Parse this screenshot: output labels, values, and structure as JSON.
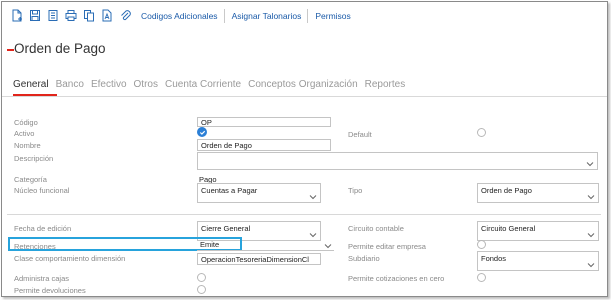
{
  "toolbar": {
    "icons": [
      "new-document-icon",
      "save-icon",
      "list-icon",
      "print-icon",
      "copy-document-icon",
      "pdf-icon",
      "attach-icon"
    ],
    "links": [
      "Codigos Adicionales",
      "Asignar Talonarios",
      "Permisos"
    ]
  },
  "page": {
    "title": "Orden de Pago"
  },
  "tabs": [
    "General",
    "Banco",
    "Efectivo",
    "Otros",
    "Cuenta Corriente",
    "Conceptos Organización",
    "Reportes"
  ],
  "active_tab": "General",
  "form": {
    "codigo": {
      "label": "Código",
      "value": "OP"
    },
    "activo": {
      "label": "Activo",
      "checked": true
    },
    "default": {
      "label": "Default",
      "checked": false
    },
    "nombre": {
      "label": "Nombre",
      "value": "Orden de Pago"
    },
    "descripcion": {
      "label": "Descripción",
      "value": ""
    },
    "categoria": {
      "label": "Categoría",
      "value": "Pago"
    },
    "nucleo": {
      "label": "Núcleo funcional",
      "value": "Cuentas a Pagar"
    },
    "tipo": {
      "label": "Tipo",
      "value": "Orden de Pago"
    },
    "fecha_edicion": {
      "label": "Fecha de edición",
      "value": "Cierre General"
    },
    "circuito": {
      "label": "Circuito contable",
      "value": "Circuito General"
    },
    "retenciones": {
      "label": "Retenciones",
      "value": "Emite"
    },
    "permite_editar_empresa": {
      "label": "Permite editar empresa",
      "checked": false
    },
    "clase_comportamiento": {
      "label": "Clase comportamiento dimensión",
      "value": "OperacionTesoreriaDimensionCl"
    },
    "subdiario": {
      "label": "Subdiario",
      "value": "Fondos"
    },
    "administra_cajas": {
      "label": "Administra cajas",
      "checked": false
    },
    "permite_cotizaciones": {
      "label": "Permite cotizaciones en cero",
      "checked": false
    },
    "permite_devoluciones": {
      "label": "Permite devoluciones",
      "checked": false
    }
  },
  "colors": {
    "accent_red": "#e1251b",
    "link_blue": "#1a5aa8",
    "highlight_blue": "#27a3dc",
    "check_blue": "#2b7fd6"
  }
}
